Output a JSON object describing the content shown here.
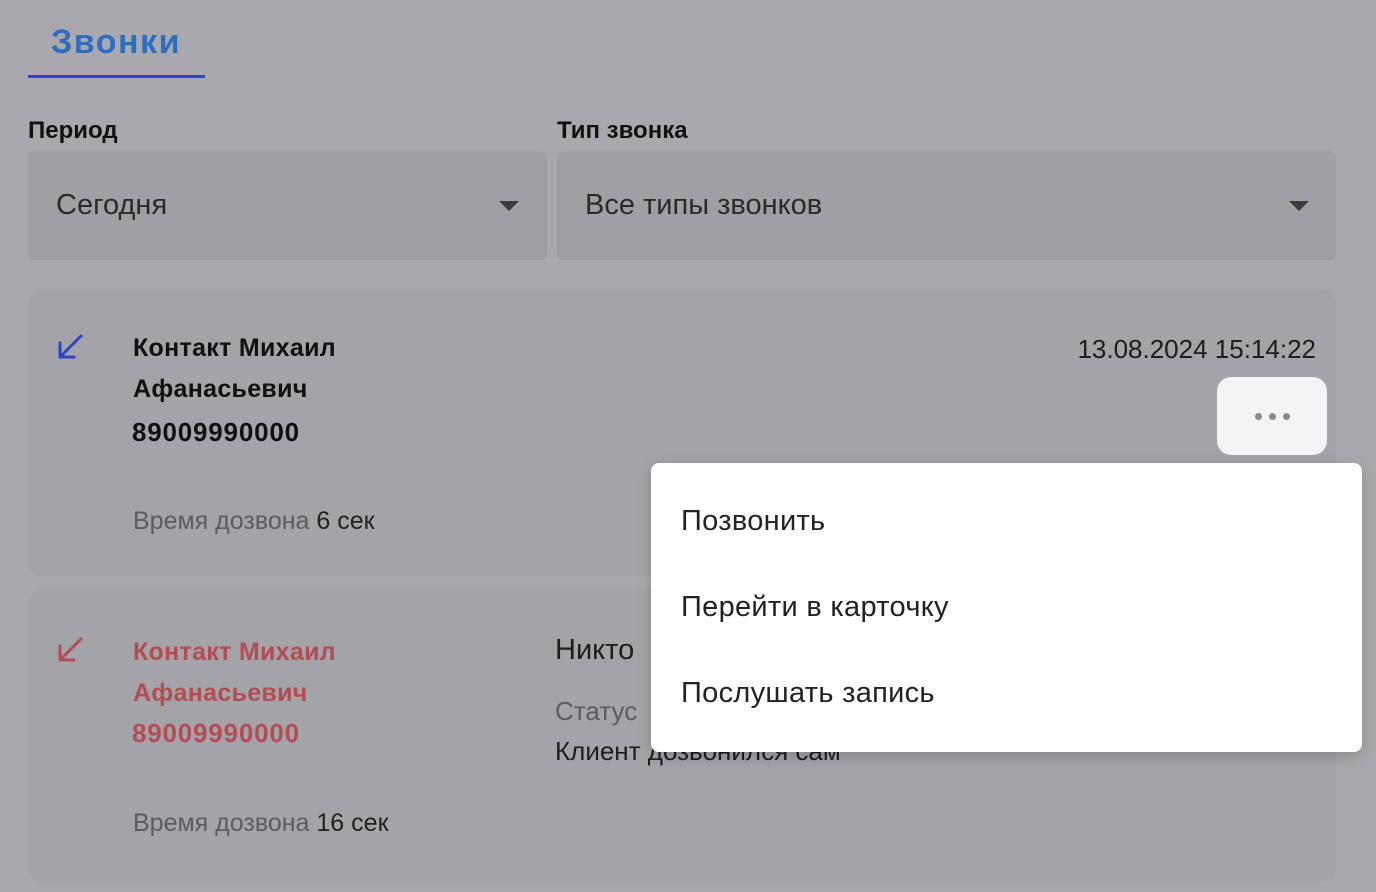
{
  "header": {
    "tab_label": "Звонки"
  },
  "filters": {
    "period": {
      "label": "Период",
      "value": "Сегодня"
    },
    "call_type": {
      "label": "Тип звонка",
      "value": "Все типы звонков"
    }
  },
  "calls": [
    {
      "contact_line1": "Контакт Михаил",
      "contact_line2": "Афанасьевич",
      "phone": "89009990000",
      "datetime": "13.08.2024 15:14:22",
      "wait_label": "Время дозвона",
      "wait_value": "6 сек",
      "icon": "incoming-call-arrow-icon",
      "color": "#2a45c6"
    },
    {
      "contact_line1": "Контакт Михаил",
      "contact_line2": "Афанасьевич",
      "phone": "89009990000",
      "answered_by": "Никто",
      "status_label": "Статус",
      "status_value": "Клиент дозвонился сам",
      "wait_label": "Время дозвона",
      "wait_value": "16 сек",
      "icon": "missed-call-arrow-icon",
      "color": "#b34d52"
    }
  ],
  "menu": {
    "items": [
      "Позвонить",
      "Перейти в карточку",
      "Послушать запись"
    ]
  }
}
